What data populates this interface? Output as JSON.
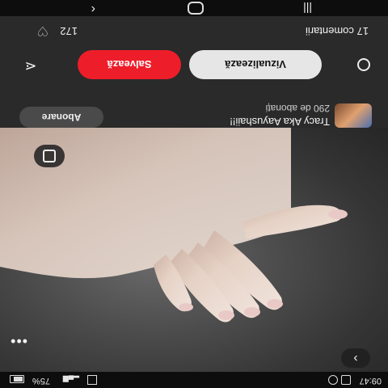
{
  "status_bar": {
    "time": "09:47",
    "battery": "75%"
  },
  "channel": {
    "name": "Tracy Aka Aayushaii!!",
    "subscribers": "290 de abonați",
    "subscribe_label": "Abonare"
  },
  "actions": {
    "view_label": "Vizualizează",
    "save_label": "Salvează",
    "save_color": "#ee1d2a"
  },
  "comments": {
    "label": "17 comentarii"
  },
  "likes": {
    "count": "172"
  },
  "icons": [
    "lens-icon",
    "share-icon",
    "more-icon",
    "next-icon",
    "heart-icon",
    "back-icon",
    "home-icon",
    "recents-icon"
  ]
}
